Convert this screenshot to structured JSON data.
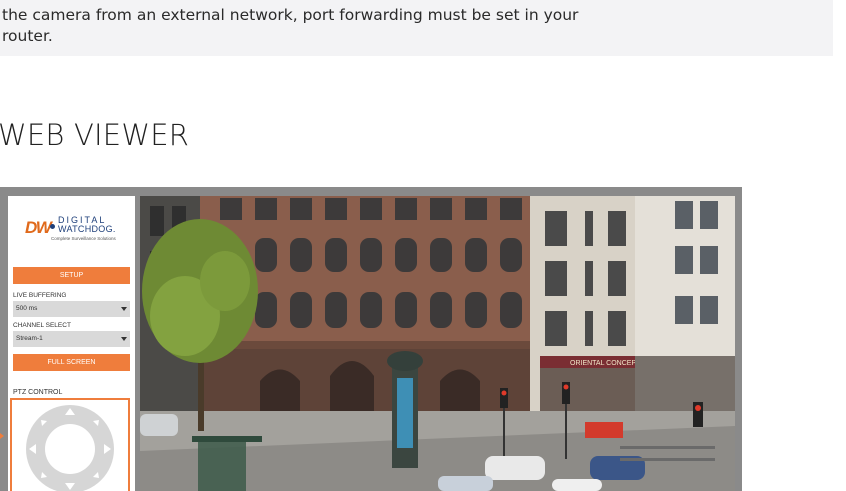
{
  "page": {
    "note_line1": "the camera from an external network, port forwarding must be set in your",
    "note_line2": "router.",
    "section_title": "WEB VIEWER"
  },
  "viewer": {
    "logo": {
      "mark": "DW",
      "line1": "DIGITAL",
      "line2": "WATCHDOG.",
      "tagline": "Complete Surveillance Solutions"
    },
    "setup_label": "SETUP",
    "live_buffering": {
      "label": "LIVE BUFFERING",
      "value": "500 ms"
    },
    "channel_select": {
      "label": "CHANNEL SELECT",
      "value": "Stream-1"
    },
    "full_screen_label": "FULL SCREEN",
    "ptz_label": "PTZ CONTROL",
    "camera_feed": {
      "shop_sign": "ORIENTAL CONCEPTS"
    },
    "icons": [
      "chevron-down-icon",
      "ptz-up-icon",
      "ptz-down-icon",
      "ptz-left-icon",
      "ptz-right-icon",
      "caret-right-icon"
    ],
    "colors": {
      "accent": "#ef7d3c",
      "brand_blue": "#1e3f7a",
      "frame": "#8a8a8a"
    }
  }
}
